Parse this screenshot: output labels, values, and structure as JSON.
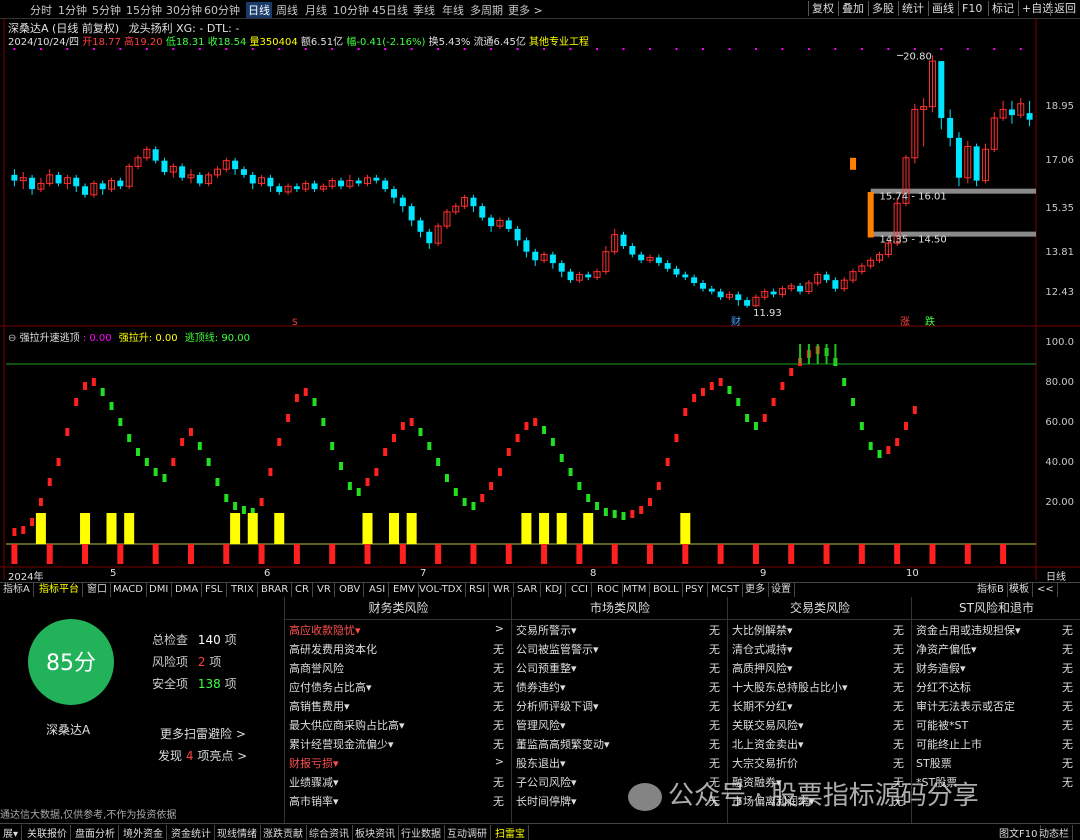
{
  "toolbar": {
    "periods": [
      "分时",
      "1分钟",
      "5分钟",
      "15分钟",
      "30分钟",
      "60分钟",
      "日线",
      "周线",
      "月线",
      "10分钟",
      "45日线",
      "季线",
      "年线",
      "多周期",
      "更多 >"
    ],
    "active_period": "日线",
    "right_buttons": [
      "复权",
      "叠加",
      "多股",
      "统计",
      "画线",
      "F10",
      "标记",
      "+自选",
      "返回"
    ]
  },
  "title": {
    "stock": "深桑达A",
    "mode": "(日线 前复权)",
    "indicator": "龙头扬利 XG: - DTL: -"
  },
  "info": {
    "date": "2024/10/24/四",
    "open_label": "开",
    "open": "18.77",
    "high_label": "高",
    "high": "19.20",
    "low_label": "低",
    "low": "18.31",
    "close_label": "收",
    "close": "18.54",
    "vol_label": "量",
    "vol": "350404",
    "amount": "额6.51亿",
    "change": "幅-0.41(-2.16%)",
    "turnover": "换5.43%",
    "float": "流通6.45亿",
    "sector": "其他专业工程"
  },
  "price_axis": [
    "18.95",
    "17.06",
    "15.35",
    "13.81",
    "12.43"
  ],
  "annotations": {
    "high_price": "20.80",
    "low_price": "11.93",
    "gap1": "15.74 - 16.01",
    "gap2": "14.35 - 14.50",
    "marker_s": "S",
    "marker_cai": "财",
    "marker_zhang": "涨",
    "marker_die": "跌"
  },
  "sub_indicator": {
    "name": "强拉升速逃顶",
    "field1": ": 0.00",
    "field2_label": "强拉升: 0.00",
    "field3_label": "逃顶线: 90.00"
  },
  "sub_axis": [
    "100.0",
    "80.00",
    "60.00",
    "40.00",
    "20.00"
  ],
  "date_axis": [
    "2024年",
    "5",
    "6",
    "7",
    "8",
    "9",
    "10"
  ],
  "date_axis_right": "日线",
  "indicator_tabs": [
    "指标A",
    "指标平台",
    "窗口",
    "MACD",
    "DMI",
    "DMA",
    "FSL",
    "TRIX",
    "BRAR",
    "CR",
    "VR",
    "OBV",
    "ASI",
    "EMV",
    "VOL-TDX",
    "RSI",
    "WR",
    "SAR",
    "KDJ",
    "CCI",
    "ROC",
    "MTM",
    "BOLL",
    "PSY",
    "MCST",
    "更多",
    "设置"
  ],
  "indicator_tabs_right": [
    "指标B",
    "模板",
    "<<"
  ],
  "score": {
    "value": "85分",
    "name": "深桑达A",
    "total_label": "总检查",
    "total": "140",
    "total_unit": "项",
    "risk_label": "风险项",
    "risk": "2",
    "risk_unit": "项",
    "safe_label": "安全项",
    "safe": "138",
    "safe_unit": "项",
    "more": "更多扫雷避险 >",
    "found_prefix": "发现",
    "found": "4",
    "found_suffix": "项亮点 >"
  },
  "risk_columns": [
    {
      "title": "财务类风险",
      "rows": [
        {
          "n": "高应收款隐忧▾",
          "v": ">",
          "red": true
        },
        {
          "n": "高研发费用资本化",
          "v": "无"
        },
        {
          "n": "高商誉风险",
          "v": "无"
        },
        {
          "n": "应付债务占比高▾",
          "v": "无"
        },
        {
          "n": "高销售费用▾",
          "v": "无"
        },
        {
          "n": "最大供应商采购占比高▾",
          "v": "无"
        },
        {
          "n": "累计经营现金流偏少▾",
          "v": "无"
        },
        {
          "n": "财报亏损▾",
          "v": ">",
          "red": true
        },
        {
          "n": "业绩骤减▾",
          "v": "无"
        },
        {
          "n": "高市销率▾",
          "v": "无"
        }
      ]
    },
    {
      "title": "市场类风险",
      "rows": [
        {
          "n": "交易所警示▾",
          "v": "无"
        },
        {
          "n": "公司被监管警示▾",
          "v": "无"
        },
        {
          "n": "公司预重整▾",
          "v": "无"
        },
        {
          "n": "债券违约▾",
          "v": "无"
        },
        {
          "n": "分析师评级下调▾",
          "v": "无"
        },
        {
          "n": "管理风险▾",
          "v": "无"
        },
        {
          "n": "董监高高频繁变动▾",
          "v": "无"
        },
        {
          "n": "股东退出▾",
          "v": "无"
        },
        {
          "n": "子公司风险▾",
          "v": "无"
        },
        {
          "n": "长时间停牌▾",
          "v": "无"
        }
      ]
    },
    {
      "title": "交易类风险",
      "rows": [
        {
          "n": "大比例解禁▾",
          "v": "无"
        },
        {
          "n": "清仓式减持▾",
          "v": "无"
        },
        {
          "n": "高质押风险▾",
          "v": "无"
        },
        {
          "n": "十大股东总持股占比小▾",
          "v": "无"
        },
        {
          "n": "长期不分红▾",
          "v": "无"
        },
        {
          "n": "关联交易风险▾",
          "v": "无"
        },
        {
          "n": "北上资金卖出▾",
          "v": "无"
        },
        {
          "n": "大宗交易折价",
          "v": "无"
        },
        {
          "n": "融资融券▾",
          "v": "无"
        },
        {
          "n": "市场偏离利润率▾",
          "v": "无"
        }
      ]
    },
    {
      "title": "ST风险和退市",
      "rows": [
        {
          "n": "资金占用或违规担保▾",
          "v": "无"
        },
        {
          "n": "净资产偏低▾",
          "v": "无"
        },
        {
          "n": "财务造假▾",
          "v": "无"
        },
        {
          "n": "分红不达标",
          "v": "无"
        },
        {
          "n": "审计无法表示或否定",
          "v": "无"
        },
        {
          "n": "可能被*ST",
          "v": "无"
        },
        {
          "n": "可能终止上市",
          "v": "无"
        },
        {
          "n": "ST股票",
          "v": "无"
        },
        {
          "n": "*ST股票",
          "v": "无"
        },
        {
          "n": "",
          "v": ""
        }
      ]
    }
  ],
  "disclaimer": "通达信大数据,仅供参考,不作为投资依据",
  "watermark": "公众号 · 股票指标源码分享",
  "statusbar": [
    "展▾",
    "关联报价",
    "盘面分析",
    "境外资金",
    "资金统计",
    "现线情绪",
    "涨跌贡献",
    "综合资讯",
    "板块资讯",
    "行业数据",
    "互动调研",
    "扫雷宝"
  ],
  "statusbar_right": [
    "图文F10",
    "动态栏"
  ],
  "chart_data": {
    "type": "candlestick",
    "price_ylim": [
      11.5,
      21.2
    ],
    "osc_ylim": [
      0,
      100
    ],
    "up_color": "#ff3030",
    "down_color": "#00e5ff",
    "candles": [
      [
        16.6,
        16.4,
        16.8,
        16.2
      ],
      [
        16.4,
        16.5,
        16.7,
        16.1
      ],
      [
        16.5,
        16.1,
        16.6,
        15.9
      ],
      [
        16.1,
        16.3,
        16.5,
        16.0
      ],
      [
        16.3,
        16.6,
        16.8,
        16.2
      ],
      [
        16.6,
        16.3,
        16.7,
        16.2
      ],
      [
        16.3,
        16.5,
        16.6,
        16.1
      ],
      [
        16.5,
        16.2,
        16.6,
        16.0
      ],
      [
        16.2,
        15.9,
        16.3,
        15.8
      ],
      [
        15.9,
        16.3,
        16.4,
        15.8
      ],
      [
        16.3,
        16.1,
        16.4,
        15.9
      ],
      [
        16.1,
        16.4,
        16.5,
        16.0
      ],
      [
        16.4,
        16.2,
        16.5,
        16.1
      ],
      [
        16.2,
        16.9,
        17.0,
        16.1
      ],
      [
        16.9,
        17.2,
        17.3,
        16.8
      ],
      [
        17.2,
        17.5,
        17.6,
        17.1
      ],
      [
        17.5,
        17.1,
        17.6,
        17.0
      ],
      [
        17.1,
        16.7,
        17.2,
        16.6
      ],
      [
        16.7,
        16.9,
        17.0,
        16.5
      ],
      [
        16.9,
        16.5,
        17.0,
        16.4
      ],
      [
        16.5,
        16.6,
        16.8,
        16.3
      ],
      [
        16.6,
        16.3,
        16.7,
        16.2
      ],
      [
        16.3,
        16.6,
        16.7,
        16.2
      ],
      [
        16.6,
        16.8,
        16.9,
        16.5
      ],
      [
        16.8,
        17.1,
        17.2,
        16.7
      ],
      [
        17.1,
        16.8,
        17.2,
        16.6
      ],
      [
        16.8,
        16.6,
        16.9,
        16.5
      ],
      [
        16.6,
        16.3,
        16.7,
        16.1
      ],
      [
        16.3,
        16.5,
        16.6,
        16.2
      ],
      [
        16.5,
        16.2,
        16.6,
        16.0
      ],
      [
        16.2,
        16.0,
        16.3,
        15.9
      ],
      [
        16.0,
        16.2,
        16.3,
        15.9
      ],
      [
        16.2,
        16.1,
        16.3,
        16.0
      ],
      [
        16.1,
        16.3,
        16.4,
        16.0
      ],
      [
        16.3,
        16.1,
        16.4,
        16.0
      ],
      [
        16.1,
        16.2,
        16.3,
        16.0
      ],
      [
        16.2,
        16.4,
        16.5,
        16.1
      ],
      [
        16.4,
        16.2,
        16.5,
        16.1
      ],
      [
        16.2,
        16.4,
        16.6,
        16.1
      ],
      [
        16.4,
        16.3,
        16.5,
        16.2
      ],
      [
        16.3,
        16.5,
        16.6,
        16.2
      ],
      [
        16.5,
        16.4,
        16.6,
        16.3
      ],
      [
        16.4,
        16.1,
        16.5,
        16.0
      ],
      [
        16.1,
        15.8,
        16.2,
        15.6
      ],
      [
        15.8,
        15.5,
        15.9,
        15.3
      ],
      [
        15.5,
        15.0,
        15.6,
        14.8
      ],
      [
        15.0,
        14.6,
        15.1,
        14.4
      ],
      [
        14.6,
        14.2,
        14.7,
        14.0
      ],
      [
        14.2,
        14.8,
        14.9,
        14.1
      ],
      [
        14.8,
        15.3,
        15.4,
        14.7
      ],
      [
        15.3,
        15.5,
        15.6,
        15.2
      ],
      [
        15.5,
        15.8,
        15.9,
        15.4
      ],
      [
        15.8,
        15.5,
        15.9,
        15.3
      ],
      [
        15.5,
        15.1,
        15.6,
        15.0
      ],
      [
        15.1,
        14.8,
        15.2,
        14.6
      ],
      [
        14.8,
        15.0,
        15.1,
        14.7
      ],
      [
        15.0,
        14.7,
        15.1,
        14.6
      ],
      [
        14.7,
        14.3,
        14.8,
        14.1
      ],
      [
        14.3,
        13.9,
        14.4,
        13.7
      ],
      [
        13.9,
        13.6,
        14.0,
        13.4
      ],
      [
        13.6,
        13.8,
        13.9,
        13.5
      ],
      [
        13.8,
        13.5,
        13.9,
        13.3
      ],
      [
        13.5,
        13.2,
        13.6,
        13.0
      ],
      [
        13.2,
        12.9,
        13.3,
        12.8
      ],
      [
        12.9,
        13.1,
        13.2,
        12.8
      ],
      [
        13.1,
        13.0,
        13.2,
        12.9
      ],
      [
        13.0,
        13.2,
        13.3,
        12.9
      ],
      [
        13.2,
        13.9,
        14.1,
        13.1
      ],
      [
        13.9,
        14.5,
        14.7,
        13.8
      ],
      [
        14.5,
        14.1,
        14.6,
        14.0
      ],
      [
        14.1,
        13.8,
        14.2,
        13.7
      ],
      [
        13.8,
        13.6,
        13.9,
        13.5
      ],
      [
        13.6,
        13.7,
        13.8,
        13.5
      ],
      [
        13.7,
        13.5,
        13.8,
        13.4
      ],
      [
        13.5,
        13.3,
        13.6,
        13.2
      ],
      [
        13.3,
        13.1,
        13.4,
        13.0
      ],
      [
        13.1,
        13.0,
        13.2,
        12.9
      ],
      [
        13.0,
        12.8,
        13.1,
        12.7
      ],
      [
        12.8,
        12.6,
        12.9,
        12.5
      ],
      [
        12.6,
        12.5,
        12.7,
        12.4
      ],
      [
        12.5,
        12.3,
        12.6,
        12.2
      ],
      [
        12.3,
        12.4,
        12.5,
        12.2
      ],
      [
        12.4,
        12.2,
        12.5,
        12.0
      ],
      [
        12.2,
        12.0,
        12.3,
        11.93
      ],
      [
        12.0,
        12.3,
        12.4,
        11.95
      ],
      [
        12.3,
        12.5,
        12.6,
        12.2
      ],
      [
        12.5,
        12.4,
        12.6,
        12.3
      ],
      [
        12.4,
        12.6,
        12.7,
        12.3
      ],
      [
        12.6,
        12.7,
        12.8,
        12.5
      ],
      [
        12.7,
        12.5,
        12.8,
        12.4
      ],
      [
        12.5,
        12.8,
        12.9,
        12.4
      ],
      [
        12.8,
        13.1,
        13.2,
        12.7
      ],
      [
        13.1,
        12.9,
        13.2,
        12.8
      ],
      [
        12.9,
        12.6,
        13.0,
        12.5
      ],
      [
        12.6,
        12.9,
        13.0,
        12.5
      ],
      [
        12.9,
        13.2,
        13.3,
        12.8
      ],
      [
        13.2,
        13.4,
        13.5,
        13.1
      ],
      [
        13.4,
        13.6,
        13.7,
        13.3
      ],
      [
        13.6,
        13.8,
        13.9,
        13.5
      ],
      [
        13.8,
        14.2,
        14.3,
        13.7
      ],
      [
        14.2,
        15.6,
        15.8,
        14.1
      ],
      [
        15.6,
        17.2,
        17.3,
        15.5
      ],
      [
        17.2,
        18.9,
        19.1,
        17.0
      ],
      [
        18.9,
        19.0,
        19.3,
        17.6
      ],
      [
        19.0,
        20.6,
        20.8,
        18.8
      ],
      [
        20.6,
        18.6,
        20.1,
        18.2
      ],
      [
        18.6,
        17.9,
        18.9,
        17.6
      ],
      [
        17.9,
        16.5,
        18.1,
        16.2
      ],
      [
        16.5,
        17.6,
        17.8,
        16.3
      ],
      [
        17.6,
        16.4,
        17.7,
        16.2
      ],
      [
        16.4,
        17.5,
        17.7,
        16.3
      ],
      [
        17.5,
        18.6,
        18.8,
        17.4
      ],
      [
        18.6,
        18.9,
        19.2,
        18.5
      ],
      [
        18.9,
        18.7,
        19.2,
        18.4
      ],
      [
        18.7,
        19.1,
        19.3,
        18.6
      ],
      [
        18.77,
        18.54,
        19.2,
        18.31
      ]
    ],
    "osc_values": [
      5,
      6,
      10,
      20,
      30,
      40,
      55,
      70,
      78,
      80,
      75,
      68,
      60,
      52,
      45,
      40,
      35,
      32,
      40,
      50,
      55,
      48,
      40,
      30,
      22,
      18,
      16,
      15,
      20,
      35,
      50,
      62,
      72,
      75,
      70,
      60,
      48,
      38,
      28,
      25,
      30,
      35,
      45,
      52,
      58,
      60,
      55,
      48,
      40,
      32,
      25,
      20,
      18,
      22,
      28,
      35,
      45,
      52,
      58,
      60,
      56,
      50,
      42,
      35,
      28,
      22,
      18,
      15,
      14,
      13,
      14,
      16,
      20,
      28,
      40,
      52,
      65,
      72,
      75,
      78,
      80,
      76,
      70,
      62,
      58,
      62,
      70,
      78,
      85,
      90,
      94,
      96,
      95,
      90,
      80,
      70,
      58,
      48,
      44,
      46,
      50,
      58,
      66
    ],
    "strong_pull_bars": [
      3,
      8,
      11,
      13,
      25,
      27,
      30,
      40,
      43,
      45,
      58,
      60,
      62,
      65,
      76
    ],
    "escape_top_line": 90,
    "x_dates": [
      "2024年",
      "5",
      "6",
      "7",
      "8",
      "9",
      "10"
    ]
  }
}
